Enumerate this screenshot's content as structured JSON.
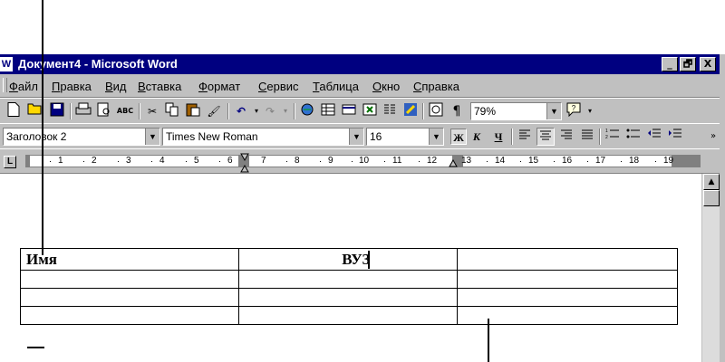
{
  "window": {
    "title": "Документ4 - Microsoft Word",
    "app_icon": "W",
    "buttons": {
      "minimize": "_",
      "maximize": "🗗",
      "close": "X"
    }
  },
  "menu": {
    "items": [
      "Файл",
      "Правка",
      "Вид",
      "Вставка",
      "Формат",
      "Сервис",
      "Таблица",
      "Окно",
      "Справка"
    ]
  },
  "toolbar": {
    "zoom": "79%",
    "paragraph_mark": "¶",
    "icons": [
      "new-icon",
      "open-icon",
      "save-icon",
      "print-icon",
      "print-preview-icon",
      "spelling-icon",
      "cut-icon",
      "copy-icon",
      "paste-icon",
      "format-painter-icon",
      "undo-icon",
      "redo-icon",
      "hyperlink-icon",
      "tables-borders-icon",
      "insert-table-icon",
      "insert-excel-icon",
      "columns-icon",
      "drawing-icon",
      "document-map-icon",
      "show-hide-icon",
      "help-icon"
    ]
  },
  "formatting": {
    "style": "Заголовок 2",
    "font": "Times New Roman",
    "size": "16",
    "bold": "Ж",
    "italic": "К",
    "underline": "Ч"
  },
  "ruler": {
    "tab_selector": "L",
    "numbers": [
      "1",
      "2",
      "3",
      "4",
      "5",
      "6",
      "7",
      "8",
      "9",
      "10",
      "11",
      "12",
      "13",
      "14",
      "15",
      "16",
      "17",
      "18",
      "19"
    ]
  },
  "document": {
    "table": [
      [
        "Имя",
        "ВУЗ",
        ""
      ],
      [
        "",
        "",
        ""
      ],
      [
        "",
        "",
        ""
      ],
      [
        "",
        "",
        ""
      ]
    ]
  }
}
